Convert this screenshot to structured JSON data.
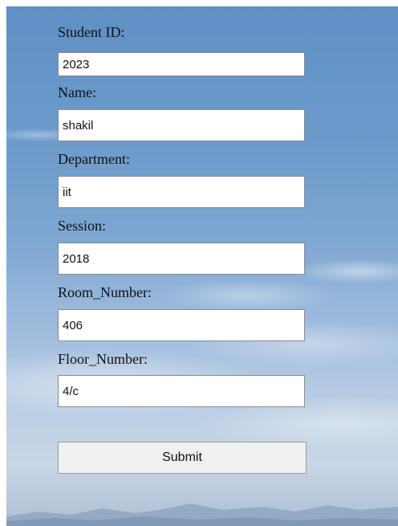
{
  "form": {
    "fields": [
      {
        "label": "Student ID:",
        "value": "2023"
      },
      {
        "label": "Name:",
        "value": "shakil"
      },
      {
        "label": "Department:",
        "value": "iit"
      },
      {
        "label": "Session:",
        "value": "2018"
      },
      {
        "label": "Room_Number:",
        "value": "406"
      },
      {
        "label": "Floor_Number:",
        "value": "4/c"
      }
    ],
    "submit_label": "Submit"
  },
  "colors": {
    "sky_top": "#5f8fc4",
    "sky_bottom": "#aebfd4",
    "button_bg": "#f0f0f0"
  }
}
